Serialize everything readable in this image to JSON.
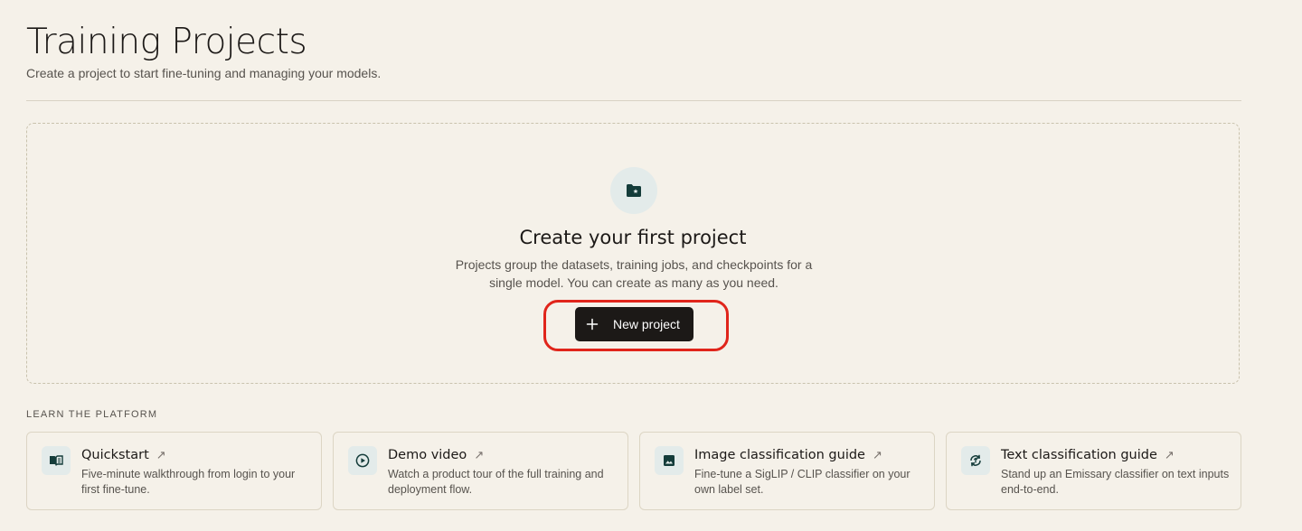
{
  "header": {
    "title": "Training Projects",
    "subtitle": "Create a project to start fine-tuning and managing your models."
  },
  "empty_state": {
    "icon": "folder-star-icon",
    "title": "Create your first project",
    "description": "Projects group the datasets, training jobs, and checkpoints for a single model. You can create as many as you need.",
    "button_label": "New project",
    "button_icon": "plus-icon"
  },
  "learn": {
    "section_label": "LEARN THE PLATFORM",
    "arrow": "↗",
    "cards": [
      {
        "title": "Quickstart",
        "description": "Five-minute walkthrough from login to your first fine-tune.",
        "icon": "book-icon"
      },
      {
        "title": "Demo video",
        "description": "Watch a product tour of the full training and deployment flow.",
        "icon": "play-icon"
      },
      {
        "title": "Image classification guide",
        "description": "Fine-tune a SigLIP / CLIP classifier on your own label set.",
        "icon": "image-icon"
      },
      {
        "title": "Text classification guide",
        "description": "Stand up an Emissary classifier on text inputs end-to-end.",
        "icon": "text-cycle-icon"
      }
    ]
  },
  "colors": {
    "background": "#f5f1e9",
    "primary_button": "#1c1917",
    "icon_tint": "#143c3a",
    "icon_bg": "#e3ebea",
    "highlight": "#e0251b"
  }
}
